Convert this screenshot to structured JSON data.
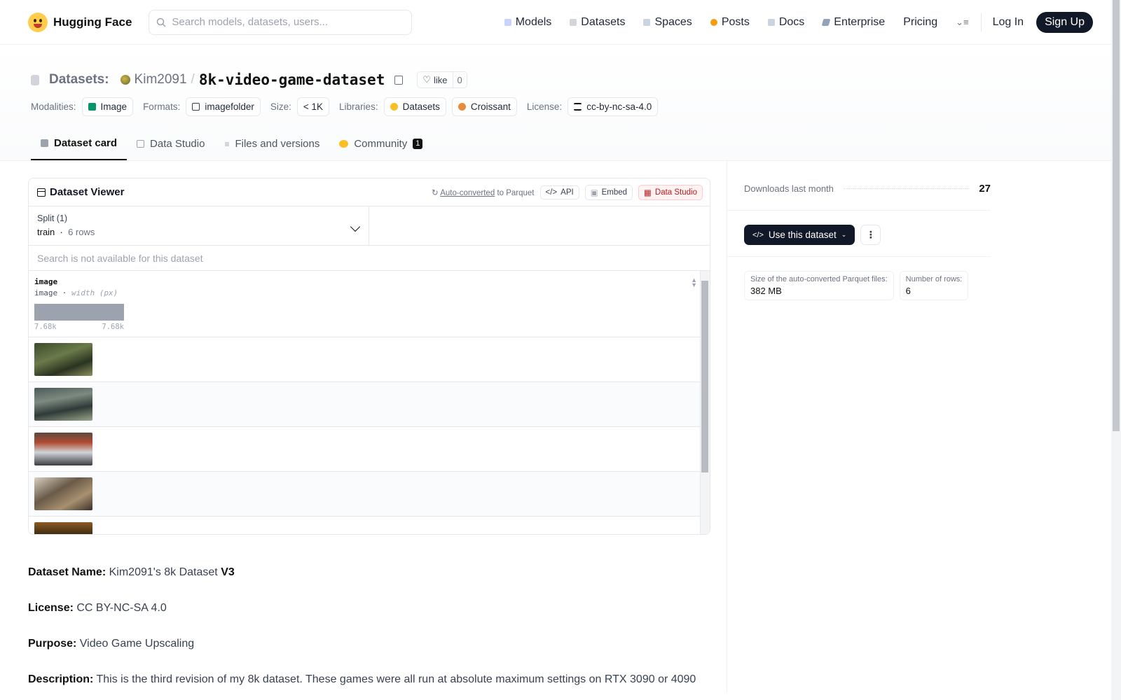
{
  "header": {
    "brand": "Hugging Face",
    "search_placeholder": "Search models, datasets, users...",
    "nav": [
      {
        "label": "Models",
        "color": "#a5b4fc"
      },
      {
        "label": "Datasets",
        "color": "#d1d5db"
      },
      {
        "label": "Spaces",
        "color": "#cbd5e1"
      },
      {
        "label": "Posts",
        "color": "#f59e0b"
      },
      {
        "label": "Docs",
        "color": "#cbd5e1"
      },
      {
        "label": "Enterprise",
        "color": "#94a3b8"
      }
    ],
    "pricing": "Pricing",
    "login": "Log In",
    "signup": "Sign Up"
  },
  "repo": {
    "section": "Datasets:",
    "owner": "Kim2091",
    "name": "8k-video-game-dataset",
    "like_label": "like",
    "like_count": "0",
    "tags": {
      "modalities_label": "Modalities:",
      "modality": "Image",
      "formats_label": "Formats:",
      "format": "imagefolder",
      "size_label": "Size:",
      "size": "< 1K",
      "libraries_label": "Libraries:",
      "lib1": "Datasets",
      "lib2": "Croissant",
      "license_label": "License:",
      "license": "cc-by-nc-sa-4.0"
    },
    "tabs": [
      {
        "label": "Dataset card"
      },
      {
        "label": "Data Studio"
      },
      {
        "label": "Files and versions"
      },
      {
        "label": "Community",
        "badge": "1"
      }
    ]
  },
  "viewer": {
    "title": "Dataset Viewer",
    "auto_converted": "Auto-converted",
    "to_parquet": "to Parquet",
    "api": "API",
    "embed": "Embed",
    "data_studio": "Data Studio",
    "split_label": "Split (1)",
    "split_value": "train",
    "split_rows": "6 rows",
    "search_disabled": "Search is not available for this dataset",
    "column_name": "image",
    "column_type": "image",
    "column_stat": "width (px)",
    "hist_min": "7.68k",
    "hist_max": "7.68k"
  },
  "card": {
    "name_label": "Dataset Name:",
    "name_value": "Kim2091's 8k Dataset",
    "name_version": "V3",
    "license_label": "License:",
    "license_value": "CC BY-NC-SA 4.0",
    "purpose_label": "Purpose:",
    "purpose_value": "Video Game Upscaling",
    "desc_label": "Description:",
    "desc_value": "This is the third revision of my 8k dataset. These games were all run at absolute maximum settings on RTX 3090 or 4090"
  },
  "sidebar": {
    "downloads_label": "Downloads last month",
    "downloads_value": "27",
    "use_button": "Use this dataset",
    "parquet_size_label": "Size of the auto-converted Parquet files:",
    "parquet_size_value": "382 MB",
    "rows_label": "Number of rows:",
    "rows_value": "6"
  }
}
